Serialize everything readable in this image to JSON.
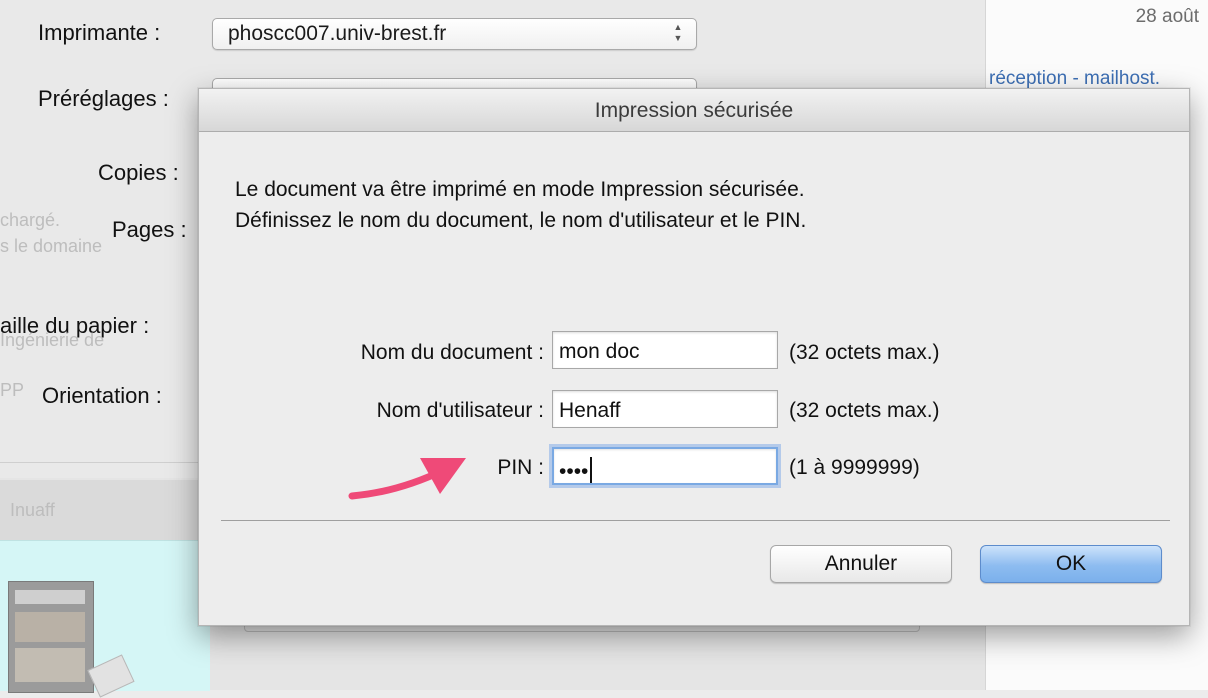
{
  "background": {
    "date": "28 août",
    "mail_link": "réception - mailhost.",
    "labels": {
      "printer": "Imprimante :",
      "presets": "Préréglages :",
      "copies": "Copies :",
      "pages": "Pages :",
      "paper_size": "aille du papier :",
      "orientation": "Orientation :"
    },
    "printer_value": "phoscc007.univ-brest.fr",
    "ghost_texts": [
      "chargé.",
      "s le domaine",
      "Ingénierie de",
      "PP",
      "Inuaff"
    ]
  },
  "dialog": {
    "title": "Impression sécurisée",
    "message_line1": "Le document va être imprimé en mode Impression sécurisée.",
    "message_line2": "Définissez le nom du document, le nom d'utilisateur et le PIN.",
    "fields": {
      "document_name": {
        "label": "Nom du document :",
        "value": "mon doc",
        "hint": "(32 octets max.)"
      },
      "user_name": {
        "label": "Nom d'utilisateur :",
        "value": "Henaff",
        "hint": "(32 octets max.)"
      },
      "pin": {
        "label": "PIN :",
        "value": "••••",
        "hint": "(1 à 9999999)"
      }
    },
    "buttons": {
      "cancel": "Annuler",
      "ok": "OK"
    }
  },
  "colors": {
    "annotation_arrow": "#ef4a78",
    "default_button": "#8dbcf0",
    "focus_ring": "#7aa9e3",
    "preview_bg": "#d5f6f6"
  },
  "icons": {
    "select_arrows": "up-down-chevron-icon",
    "annotation": "pink-arrow-icon"
  }
}
